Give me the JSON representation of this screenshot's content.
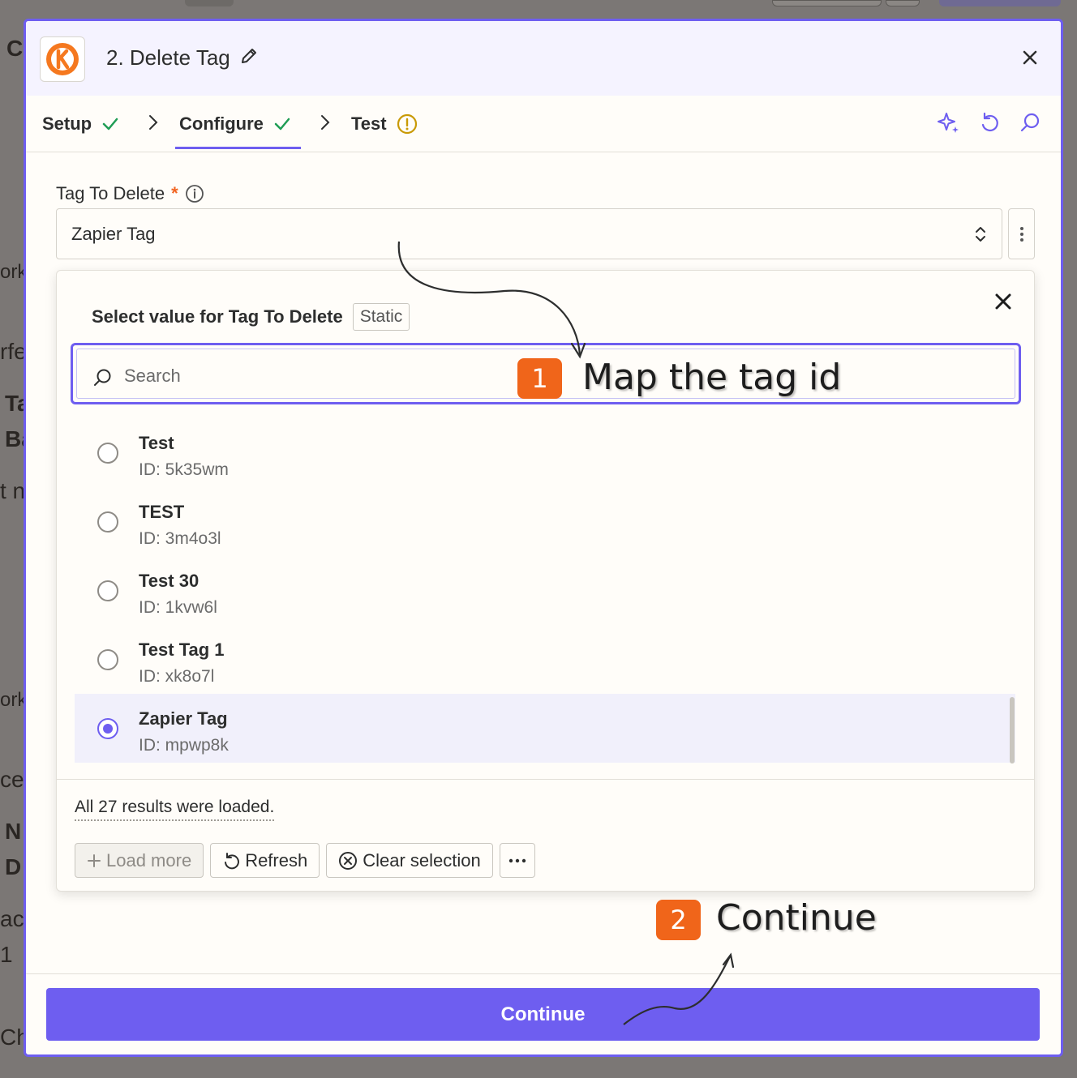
{
  "background": {
    "fragments": [
      "C",
      "ork",
      "rfe",
      "Ta",
      "Ba",
      "t n",
      "ork",
      "ce",
      "N",
      "D",
      "ac",
      "1",
      "Ch"
    ]
  },
  "modal": {
    "step_title": "2. Delete Tag",
    "icons": {
      "logo": "keap-logo-icon",
      "edit": "pencil-icon",
      "close": "close-icon"
    }
  },
  "tabs": [
    {
      "label": "Setup",
      "status": "complete"
    },
    {
      "label": "Configure",
      "status": "complete",
      "active": true
    },
    {
      "label": "Test",
      "status": "warning"
    }
  ],
  "toolbar_icons": [
    "sparkle-icon",
    "undo-icon",
    "search-icon"
  ],
  "field": {
    "label": "Tag To Delete",
    "required_mark": "*",
    "value": "Zapier Tag"
  },
  "dropdown": {
    "title": "Select value for Tag To Delete",
    "badge": "Static",
    "search_placeholder": "Search",
    "options": [
      {
        "name": "Test",
        "id_text": "ID: 5k35wm",
        "selected": false
      },
      {
        "name": "TEST",
        "id_text": "ID: 3m4o3l",
        "selected": false
      },
      {
        "name": "Test 30",
        "id_text": "ID: 1kvw6l",
        "selected": false
      },
      {
        "name": "Test Tag 1",
        "id_text": "ID: xk8o7l",
        "selected": false
      },
      {
        "name": "Zapier Tag",
        "id_text": "ID: mpwp8k",
        "selected": true
      }
    ],
    "results_note": "All 27 results were loaded.",
    "buttons": {
      "load_more": "Load more",
      "refresh": "Refresh",
      "clear_selection": "Clear selection"
    }
  },
  "annotations": [
    {
      "number": "1",
      "text": "Map the tag id"
    },
    {
      "number": "2",
      "text": "Continue"
    }
  ],
  "footer": {
    "continue_label": "Continue"
  },
  "colors": {
    "accent": "#6e5ef0",
    "annotation_orange": "#f0651a",
    "check_green": "#1f9d55",
    "warning_yellow": "#c99a06",
    "required_orange": "#f26522"
  }
}
